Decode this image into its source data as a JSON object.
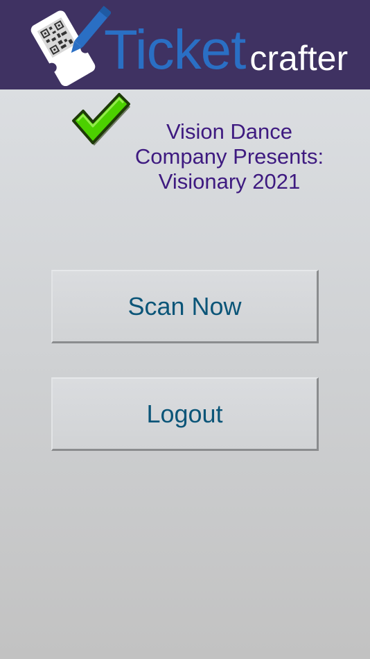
{
  "header": {
    "brand_part1": "Ticket",
    "brand_part2": "crafter",
    "logo_icon": "ticket-qr-pencil-icon",
    "background": "#3f3262"
  },
  "event": {
    "title": "Vision Dance Company Presents: Visionary 2021",
    "status_icon": "checkmark-icon"
  },
  "actions": {
    "scan_label": "Scan Now",
    "logout_label": "Logout"
  },
  "colors": {
    "title_text": "#3e1a80",
    "button_text": "#0b5578",
    "brand_blue": "#2a6fc4",
    "check_green": "#4cd000"
  }
}
